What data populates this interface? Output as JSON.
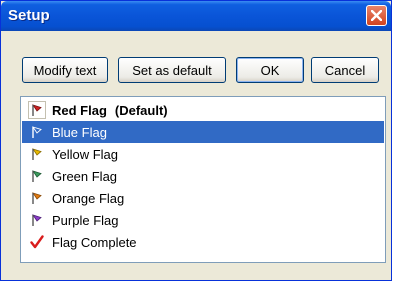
{
  "window": {
    "title": "Setup",
    "close_icon": "close-icon"
  },
  "toolbar": {
    "modify_label": "Modify text",
    "default_label": "Set as default",
    "ok_label": "OK",
    "cancel_label": "Cancel"
  },
  "flags": [
    {
      "label": "Red Flag",
      "suffix": "(Default)",
      "icon": "red-flag-icon",
      "color": "#cc2222",
      "bold": true,
      "boxed": true
    },
    {
      "label": "Blue Flag",
      "icon": "blue-flag-icon",
      "color": "#ffffff",
      "selected": true
    },
    {
      "label": "Yellow Flag",
      "icon": "yellow-flag-icon",
      "color": "#d8a800"
    },
    {
      "label": "Green Flag",
      "icon": "green-flag-icon",
      "color": "#2e8b57"
    },
    {
      "label": "Orange Flag",
      "icon": "orange-flag-icon",
      "color": "#e07a10"
    },
    {
      "label": "Purple Flag",
      "icon": "purple-flag-icon",
      "color": "#8a3cc8"
    },
    {
      "label": "Flag Complete",
      "icon": "checkmark-icon",
      "color": "#d91c1c"
    }
  ]
}
